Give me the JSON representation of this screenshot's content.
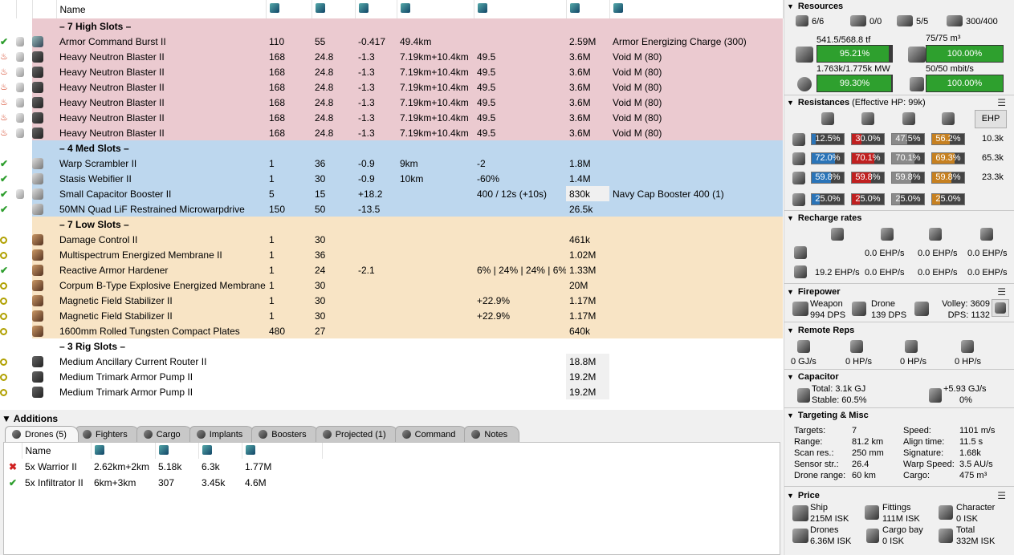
{
  "fitting": {
    "headers": {
      "name": "Name"
    },
    "sections": [
      {
        "type": "hi",
        "label": "– 7 High Slots –",
        "rows": [
          {
            "status": "check",
            "icon": "burst-icon",
            "name": "Armor Command Burst II",
            "cpu": "110",
            "pg": "55",
            "cap": "-0.417",
            "range": "49.4km",
            "misc": "",
            "price": "2.59M",
            "charge": "Armor Energizing Charge (300)"
          },
          {
            "status": "heat",
            "icon": "blaster-icon",
            "name": "Heavy Neutron Blaster II",
            "cpu": "168",
            "pg": "24.8",
            "cap": "-1.3",
            "range": "7.19km+10.4km",
            "misc": "49.5",
            "price": "3.6M",
            "charge": "Void M (80)"
          },
          {
            "status": "heat",
            "icon": "blaster-icon",
            "name": "Heavy Neutron Blaster II",
            "cpu": "168",
            "pg": "24.8",
            "cap": "-1.3",
            "range": "7.19km+10.4km",
            "misc": "49.5",
            "price": "3.6M",
            "charge": "Void M (80)"
          },
          {
            "status": "heat",
            "icon": "blaster-icon",
            "name": "Heavy Neutron Blaster II",
            "cpu": "168",
            "pg": "24.8",
            "cap": "-1.3",
            "range": "7.19km+10.4km",
            "misc": "49.5",
            "price": "3.6M",
            "charge": "Void M (80)"
          },
          {
            "status": "heat",
            "icon": "blaster-icon",
            "name": "Heavy Neutron Blaster II",
            "cpu": "168",
            "pg": "24.8",
            "cap": "-1.3",
            "range": "7.19km+10.4km",
            "misc": "49.5",
            "price": "3.6M",
            "charge": "Void M (80)"
          },
          {
            "status": "heat",
            "icon": "blaster-icon",
            "name": "Heavy Neutron Blaster II",
            "cpu": "168",
            "pg": "24.8",
            "cap": "-1.3",
            "range": "7.19km+10.4km",
            "misc": "49.5",
            "price": "3.6M",
            "charge": "Void M (80)"
          },
          {
            "status": "heat",
            "icon": "blaster-icon",
            "name": "Heavy Neutron Blaster II",
            "cpu": "168",
            "pg": "24.8",
            "cap": "-1.3",
            "range": "7.19km+10.4km",
            "misc": "49.5",
            "price": "3.6M",
            "charge": "Void M (80)"
          }
        ]
      },
      {
        "type": "med",
        "label": "– 4 Med Slots –",
        "rows": [
          {
            "status": "check",
            "icon": "scrambler-icon",
            "name": "Warp Scrambler II",
            "cpu": "1",
            "pg": "36",
            "cap": "-0.9",
            "range": "9km",
            "misc": "-2",
            "price": "1.8M",
            "charge": ""
          },
          {
            "status": "check",
            "icon": "webifier-icon",
            "name": "Stasis Webifier II",
            "cpu": "1",
            "pg": "30",
            "cap": "-0.9",
            "range": "10km",
            "misc": "-60%",
            "price": "1.4M",
            "charge": ""
          },
          {
            "status": "check",
            "icon": "cap-booster-icon",
            "name": "Small Capacitor Booster II",
            "cpu": "5",
            "pg": "15",
            "cap": "+18.2",
            "range": "",
            "misc": "400 / 12s (+10s)",
            "price": "830k",
            "charge": "Navy Cap Booster 400 (1)",
            "hl": true
          },
          {
            "status": "check",
            "icon": "mwd-icon",
            "name": "50MN Quad LiF Restrained Microwarpdrive",
            "cpu": "150",
            "pg": "50",
            "cap": "-13.5",
            "range": "",
            "misc": "",
            "price": "26.5k",
            "charge": ""
          }
        ]
      },
      {
        "type": "low",
        "label": "– 7 Low Slots –",
        "rows": [
          {
            "status": "ring",
            "icon": "damage-control-icon",
            "name": "Damage Control II",
            "cpu": "1",
            "pg": "30",
            "cap": "",
            "range": "",
            "misc": "",
            "price": "461k",
            "charge": ""
          },
          {
            "status": "ring",
            "icon": "membrane-icon",
            "name": "Multispectrum Energized Membrane II",
            "cpu": "1",
            "pg": "36",
            "cap": "",
            "range": "",
            "misc": "",
            "price": "1.02M",
            "charge": ""
          },
          {
            "status": "check",
            "icon": "hardener-icon",
            "name": "Reactive Armor Hardener",
            "cpu": "1",
            "pg": "24",
            "cap": "-2.1",
            "range": "",
            "misc": "6% | 24% | 24% | 6%",
            "price": "1.33M",
            "charge": ""
          },
          {
            "status": "ring",
            "icon": "membrane-icon",
            "name": "Corpum B-Type Explosive Energized Membrane",
            "cpu": "1",
            "pg": "30",
            "cap": "",
            "range": "",
            "misc": "",
            "price": "20M",
            "charge": ""
          },
          {
            "status": "ring",
            "icon": "stabilizer-icon",
            "name": "Magnetic Field Stabilizer II",
            "cpu": "1",
            "pg": "30",
            "cap": "",
            "range": "",
            "misc": "+22.9%",
            "price": "1.17M",
            "charge": ""
          },
          {
            "status": "ring",
            "icon": "stabilizer-icon",
            "name": "Magnetic Field Stabilizer II",
            "cpu": "1",
            "pg": "30",
            "cap": "",
            "range": "",
            "misc": "+22.9%",
            "price": "1.17M",
            "charge": ""
          },
          {
            "status": "ring",
            "icon": "plates-icon",
            "name": "1600mm Rolled Tungsten Compact Plates",
            "cpu": "480",
            "pg": "27",
            "cap": "",
            "range": "",
            "misc": "",
            "price": "640k",
            "charge": ""
          }
        ]
      },
      {
        "type": "rig",
        "label": "– 3 Rig Slots –",
        "rows": [
          {
            "status": "ring",
            "icon": "rig-icon",
            "name": "Medium Ancillary Current Router II",
            "cpu": "",
            "pg": "",
            "cap": "",
            "range": "",
            "misc": "",
            "price": "18.8M",
            "charge": "",
            "hl": true
          },
          {
            "status": "ring",
            "icon": "rig-icon",
            "name": "Medium Trimark Armor Pump II",
            "cpu": "",
            "pg": "",
            "cap": "",
            "range": "",
            "misc": "",
            "price": "19.2M",
            "charge": "",
            "hl": true
          },
          {
            "status": "ring",
            "icon": "rig-icon",
            "name": "Medium Trimark Armor Pump II",
            "cpu": "",
            "pg": "",
            "cap": "",
            "range": "",
            "misc": "",
            "price": "19.2M",
            "charge": "",
            "hl": true
          }
        ]
      }
    ]
  },
  "additions": {
    "title": "Additions",
    "tabs": [
      "Drones (5)",
      "Fighters",
      "Cargo",
      "Implants",
      "Boosters",
      "Projected (1)",
      "Command",
      "Notes"
    ],
    "drones_header": "Name",
    "drones": [
      {
        "status": "x",
        "name": "5x Warrior II",
        "range": "2.62km+2km",
        "v1": "5.18k",
        "v2": "6.3k",
        "price": "1.77M"
      },
      {
        "status": "check",
        "name": "5x Infiltrator II",
        "range": "6km+3km",
        "v1": "307",
        "v2": "3.45k",
        "price": "4.6M"
      }
    ]
  },
  "resources": {
    "title": "Resources",
    "hardpoints": [
      "6/6",
      "0/0",
      "5/5",
      "300/400"
    ],
    "cpu_text": "541.5/568.8 tf",
    "cpu_pct": "95.21%",
    "cpu_frac": 0.9521,
    "bay_text": "75/75 m³",
    "bay_pct": "100.00%",
    "bay_frac": 1.0,
    "pg_text": "1.763k/1.775k MW",
    "pg_pct": "99.30%",
    "pg_frac": 0.993,
    "bw_text": "50/50 mbit/s",
    "bw_pct": "100.00%",
    "bw_frac": 1.0
  },
  "resistances": {
    "title": "Resistances",
    "sub": "(Effective HP: 99k)",
    "ehp_button": "EHP",
    "rows": [
      {
        "vals": [
          "12.5%",
          "30.0%",
          "47.5%",
          "56.2%"
        ],
        "fr": [
          0.125,
          0.3,
          0.475,
          0.562
        ],
        "ehp": "10.3k"
      },
      {
        "vals": [
          "72.0%",
          "70.1%",
          "70.1%",
          "69.3%"
        ],
        "fr": [
          0.72,
          0.701,
          0.701,
          0.693
        ],
        "ehp": "65.3k"
      },
      {
        "vals": [
          "59.8%",
          "59.8%",
          "59.8%",
          "59.8%"
        ],
        "fr": [
          0.598,
          0.598,
          0.598,
          0.598
        ],
        "ehp": "23.3k"
      },
      {
        "vals": [
          "25.0%",
          "25.0%",
          "25.0%",
          "25.0%"
        ],
        "fr": [
          0.25,
          0.25,
          0.25,
          0.25
        ],
        "ehp": ""
      }
    ],
    "colors": [
      "#2a74b8",
      "#c02020",
      "#8a8a8a",
      "#c68020"
    ]
  },
  "recharge": {
    "title": "Recharge rates",
    "row1": [
      "0.0 EHP/s",
      "0.0 EHP/s",
      "0.0 EHP/s"
    ],
    "row2": [
      "19.2 EHP/s",
      "0.0 EHP/s",
      "0.0 EHP/s",
      "0.0 EHP/s"
    ]
  },
  "firepower": {
    "title": "Firepower",
    "weapon_label": "Weapon",
    "weapon_dps": "994 DPS",
    "drone_label": "Drone",
    "drone_dps": "139 DPS",
    "volley": "Volley: 3609",
    "dps": "DPS: 1132"
  },
  "remote": {
    "title": "Remote Reps",
    "vals": [
      "0 GJ/s",
      "0 HP/s",
      "0 HP/s",
      "0 HP/s"
    ]
  },
  "capacitor": {
    "title": "Capacitor",
    "total": "Total: 3.1k GJ",
    "stable": "Stable: 60.5%",
    "rate": "+5.93 GJ/s",
    "pct": "0%"
  },
  "targeting": {
    "title": "Targeting & Misc",
    "left": [
      [
        "Targets:",
        "7"
      ],
      [
        "Range:",
        "81.2 km"
      ],
      [
        "Scan res.:",
        "250 mm"
      ],
      [
        "Sensor str.:",
        "26.4"
      ],
      [
        "Drone range:",
        "60 km"
      ]
    ],
    "right": [
      [
        "Speed:",
        "1101 m/s"
      ],
      [
        "Align time:",
        "11.5 s"
      ],
      [
        "Signature:",
        "1.68k"
      ],
      [
        "Warp Speed:",
        "3.5 AU/s"
      ],
      [
        "Cargo:",
        "475 m³"
      ]
    ]
  },
  "price": {
    "title": "Price",
    "ship_label": "Ship",
    "ship": "215M ISK",
    "fittings_label": "Fittings",
    "fittings": "111M ISK",
    "character_label": "Character",
    "character": "0 ISK",
    "drones_label": "Drones",
    "drones": "6.36M ISK",
    "cargo_label": "Cargo bay",
    "cargo": "0 ISK",
    "total_label": "Total",
    "total": "332M ISK"
  }
}
